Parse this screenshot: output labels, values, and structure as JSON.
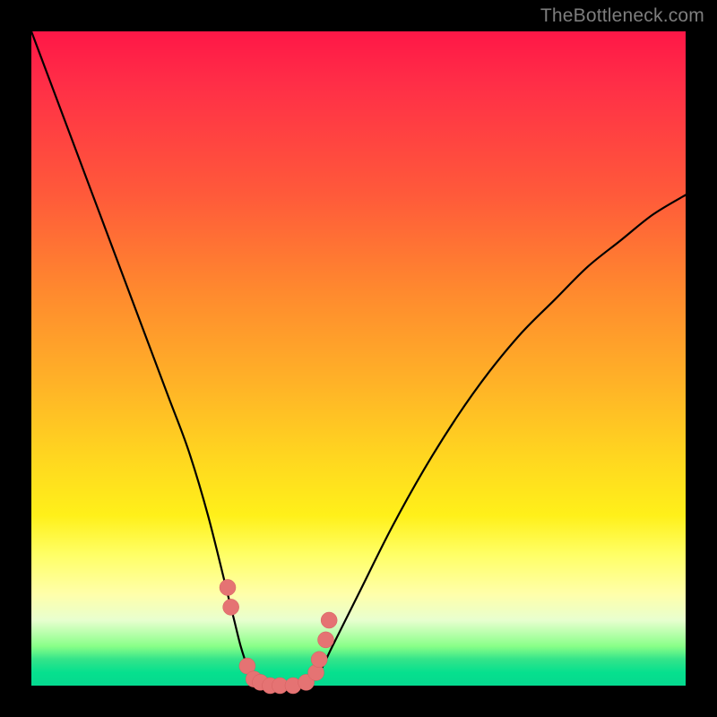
{
  "watermark": "TheBottleneck.com",
  "chart_data": {
    "type": "line",
    "title": "",
    "xlabel": "",
    "ylabel": "",
    "xlim": [
      0,
      100
    ],
    "ylim": [
      0,
      100
    ],
    "grid": false,
    "legend": false,
    "background": "red-yellow-green vertical gradient",
    "series": [
      {
        "name": "bottleneck-curve",
        "x": [
          0,
          3,
          6,
          9,
          12,
          15,
          18,
          21,
          24,
          27,
          30,
          31,
          32,
          33,
          34,
          36,
          38,
          40,
          42,
          44,
          46,
          50,
          55,
          60,
          65,
          70,
          75,
          80,
          85,
          90,
          95,
          100
        ],
        "y": [
          100,
          92,
          84,
          76,
          68,
          60,
          52,
          44,
          36,
          26,
          14,
          10,
          6,
          3,
          1,
          0,
          0,
          0,
          0,
          2,
          6,
          14,
          24,
          33,
          41,
          48,
          54,
          59,
          64,
          68,
          72,
          75
        ]
      }
    ],
    "markers": {
      "name": "pink-points",
      "points": [
        {
          "x": 30,
          "y": 15
        },
        {
          "x": 30.5,
          "y": 12
        },
        {
          "x": 33,
          "y": 3
        },
        {
          "x": 34,
          "y": 1
        },
        {
          "x": 35,
          "y": 0.5
        },
        {
          "x": 36.5,
          "y": 0
        },
        {
          "x": 38,
          "y": 0
        },
        {
          "x": 40,
          "y": 0
        },
        {
          "x": 42,
          "y": 0.5
        },
        {
          "x": 43.5,
          "y": 2
        },
        {
          "x": 44,
          "y": 4
        },
        {
          "x": 45,
          "y": 7
        },
        {
          "x": 45.5,
          "y": 10
        }
      ]
    },
    "optimal_zone_y": [
      0,
      4
    ]
  }
}
